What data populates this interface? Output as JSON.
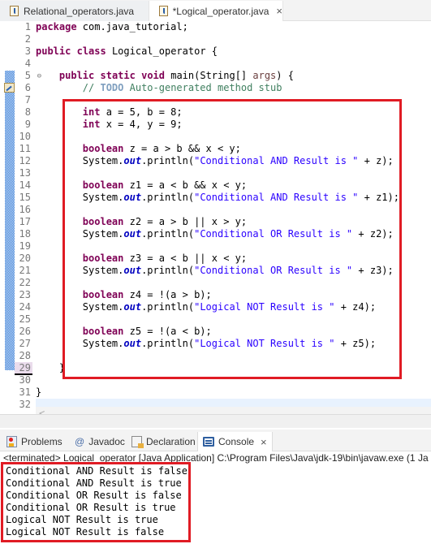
{
  "editor_tabs": [
    {
      "label": "Relational_operators.java",
      "active": false
    },
    {
      "label": "*Logical_operator.java",
      "active": true,
      "close": "×"
    }
  ],
  "line_numbers": [
    "1",
    "2",
    "3",
    "4",
    "5",
    "6",
    "7",
    "8",
    "9",
    "10",
    "11",
    "12",
    "13",
    "14",
    "15",
    "16",
    "17",
    "18",
    "19",
    "20",
    "21",
    "22",
    "23",
    "24",
    "25",
    "26",
    "27",
    "28",
    "29",
    "30",
    "31",
    "32"
  ],
  "code": {
    "l1_kw": "package",
    "l1_rest": " com.java_tutorial;",
    "l3_kw1": "public",
    "l3_kw2": "class",
    "l3_rest": " Logical_operator {",
    "l5_kw1": "public",
    "l5_kw2": "static",
    "l5_kw3": "void",
    "l5_rest1": " main(String[] ",
    "l5_args": "args",
    "l5_rest2": ") {",
    "l6_cmt1": "// ",
    "l6_todo": "TODO",
    "l6_cmt2": " Auto-generated method stub",
    "l8_kw": "int",
    "l8_rest": " a = 5, b = 8;",
    "l9_kw": "int",
    "l9_rest": " x = 4, y = 9;",
    "l11_kw": "boolean",
    "l11_rest": " z = a > b && x < y;",
    "l12_a": "System.",
    "l12_out": "out",
    "l12_b": ".println(",
    "l12_str": "\"Conditional AND Result is \"",
    "l12_c": " + z);",
    "l14_kw": "boolean",
    "l14_rest": " z1 = a < b && x < y;",
    "l15_a": "System.",
    "l15_out": "out",
    "l15_b": ".println(",
    "l15_str": "\"Conditional AND Result is \"",
    "l15_c": " + z1);",
    "l17_kw": "boolean",
    "l17_rest": " z2 = a > b || x > y;",
    "l18_a": "System.",
    "l18_out": "out",
    "l18_b": ".println(",
    "l18_str": "\"Conditional OR Result is \"",
    "l18_c": " + z2);",
    "l20_kw": "boolean",
    "l20_rest": " z3 = a < b || x < y;",
    "l21_a": "System.",
    "l21_out": "out",
    "l21_b": ".println(",
    "l21_str": "\"Conditional OR Result is \"",
    "l21_c": " + z3);",
    "l23_kw": "boolean",
    "l23_rest": " z4 = !(a > b);",
    "l24_a": "System.",
    "l24_out": "out",
    "l24_b": ".println(",
    "l24_str": "\"Logical NOT Result is \"",
    "l24_c": " + z4);",
    "l26_kw": "boolean",
    "l26_rest": " z5 = !(a < b);",
    "l27_a": "System.",
    "l27_out": "out",
    "l27_b": ".println(",
    "l27_str": "\"Logical NOT Result is \"",
    "l27_c": " + z5);",
    "l29": "    }",
    "l31": "}"
  },
  "scroll_left": "<",
  "panel_tabs": [
    {
      "label": "Problems"
    },
    {
      "label": "Javadoc",
      "icon_glyph": "@"
    },
    {
      "label": "Declaration"
    },
    {
      "label": "Console",
      "active": true,
      "close": "×"
    }
  ],
  "console": {
    "terminated": "<terminated> Logical_operator [Java Application] C:\\Program Files\\Java\\jdk-19\\bin\\javaw.exe  (1 Ja",
    "output": [
      "Conditional AND Result is false",
      "Conditional AND Result is true",
      "Conditional OR Result is false",
      "Conditional OR Result is true",
      "Logical NOT Result is true",
      "Logical NOT Result is false"
    ]
  },
  "colors": {
    "highlight_box": "#e01b24",
    "keyword": "#7f0055",
    "string": "#2a00ff",
    "comment": "#3f7f5f"
  }
}
